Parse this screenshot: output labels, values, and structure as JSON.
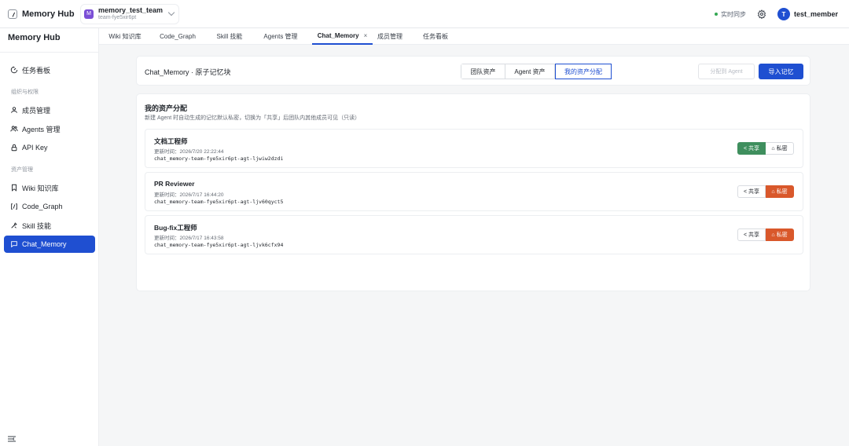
{
  "app": {
    "logo_text": "Memory Hub",
    "team": {
      "avatar_letter": "M",
      "name": "memory_test_team",
      "id": "team-fye5xir6pt"
    },
    "sync_status": "实时同步",
    "user": {
      "avatar_letter": "T",
      "name": "test_member"
    },
    "colors": {
      "primary": "#1f4fd1",
      "share": "#3f8f5e",
      "private": "#d9582b",
      "sync_dot": "#34a853"
    }
  },
  "sidebar": {
    "title": "Memory Hub",
    "items": [
      {
        "label": "任务看板",
        "icon": "dashboard-icon"
      },
      {
        "label": "成员管理",
        "icon": "user-icon"
      },
      {
        "label": "Agents 管理",
        "icon": "users-icon"
      },
      {
        "label": "API Key",
        "icon": "lock-icon"
      },
      {
        "label": "Wiki 知识库",
        "icon": "bookmark-icon"
      },
      {
        "label": "Code_Graph",
        "icon": "code-icon"
      },
      {
        "label": "Skill 技能",
        "icon": "skill-icon"
      },
      {
        "label": "Chat_Memory",
        "icon": "chat-icon"
      }
    ],
    "groups": {
      "org": "组织与权限",
      "assets": "资产管理"
    }
  },
  "tabs": [
    {
      "label": "Wiki 知识库"
    },
    {
      "label": "Code_Graph"
    },
    {
      "label": "Skill 技能"
    },
    {
      "label": "Agents 管理"
    },
    {
      "label": "Chat_Memory",
      "close": "×"
    },
    {
      "label": "成员管理"
    },
    {
      "label": "任务看板"
    }
  ],
  "header": {
    "title": "Chat_Memory · 原子记忆块",
    "segments": [
      "团队资产",
      "Agent 资产",
      "我的资产分配"
    ],
    "assign_label": "分配到 Agent",
    "import_label": "导入记忆"
  },
  "section": {
    "title": "我的资产分配",
    "desc": "新建 Agent 时自动生成的记忆默认私密，切换为「共享」后团队内其他成员可见（只读）",
    "share_label": "共享",
    "private_label": "私密",
    "items": [
      {
        "name": "文档工程师",
        "time": "更新时间：2026/7/20 22:22:44",
        "id": "chat_memory-team-fye5xir6pt-agt-ljwiw2dzdi",
        "state": "共享"
      },
      {
        "name": "PR Reviewer",
        "time": "更新时间：2026/7/17 16:44:20",
        "id": "chat_memory-team-fye5xir6pt-agt-ljv60qyct5",
        "state": "私密"
      },
      {
        "name": "Bug-fix工程师",
        "time": "更新时间：2026/7/17 16:43:58",
        "id": "chat_memory-team-fye5xir6pt-agt-ljvk6cfx94",
        "state": "私密"
      }
    ]
  }
}
